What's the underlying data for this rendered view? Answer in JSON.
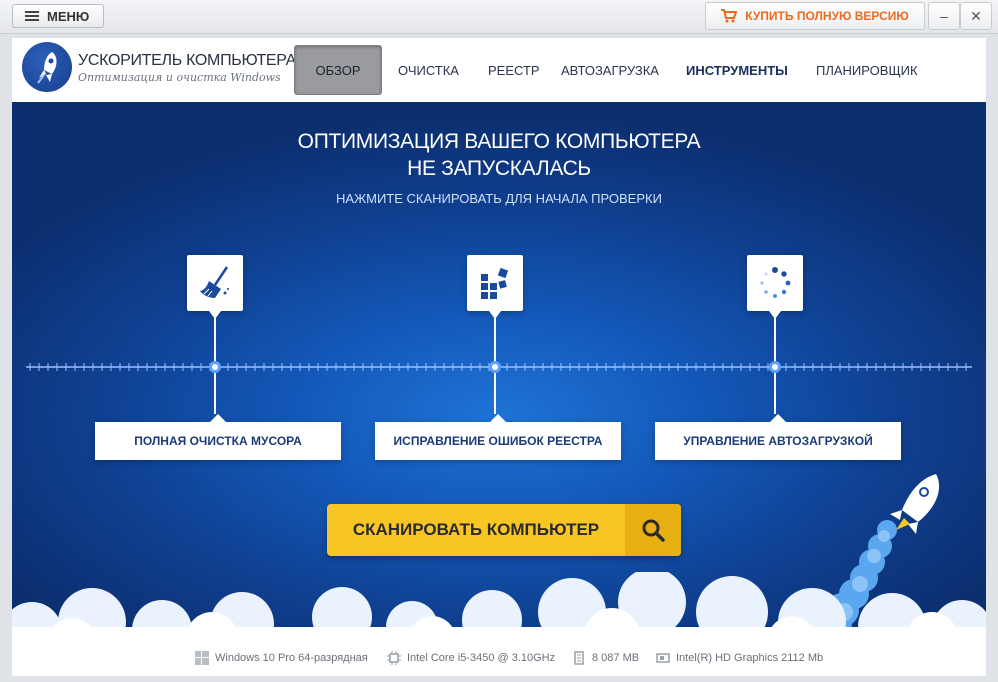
{
  "titlebar": {
    "menu_label": "МЕНЮ",
    "buy_label": "КУПИТЬ ПОЛНУЮ ВЕРСИЮ",
    "minimize_glyph": "–",
    "close_glyph": "✕",
    "accent_color": "#ef6a1f"
  },
  "app": {
    "title": "УСКОРИТЕЛЬ КОМПЬЮТЕРА",
    "subtitle": "Оптимизация и очистка Windows",
    "logo_icon": "rocket-icon"
  },
  "nav": {
    "items": [
      {
        "label": "ОБЗОР",
        "active": true
      },
      {
        "label": "ОЧИСТКА",
        "active": false
      },
      {
        "label": "РЕЕСТР",
        "active": false
      },
      {
        "label": "АВТОЗАГРУЗКА",
        "active": false
      },
      {
        "label": "ИНСТРУМЕНТЫ",
        "active": false
      },
      {
        "label": "ПЛАНИРОВЩИК",
        "active": false
      }
    ]
  },
  "hero": {
    "title_line1": "ОПТИМИЗАЦИЯ ВАШЕГО КОМПЬЮТЕРА",
    "title_line2": "НЕ ЗАПУСКАЛАСЬ",
    "subtitle": "НАЖМИТЕ СКАНИРОВАТЬ ДЛЯ НАЧАЛА ПРОВЕРКИ",
    "features": [
      {
        "label": "ПОЛНАЯ ОЧИСТКА МУСОРА",
        "icon": "broom-icon"
      },
      {
        "label": "ИСПРАВЛЕНИЕ ОШИБОК РЕЕСТРА",
        "icon": "registry-blocks-icon"
      },
      {
        "label": "УПРАВЛЕНИЕ АВТОЗАГРУЗКОЙ",
        "icon": "spinner-icon"
      }
    ],
    "scan_button": "СКАНИРОВАТЬ КОМПЬЮТЕР",
    "scan_color": "#f7c524"
  },
  "status": {
    "os": "Windows 10 Pro 64-разрядная",
    "cpu": "Intel Core i5-3450 @ 3.10GHz",
    "ram": "8 087 MB",
    "gpu": "Intel(R) HD Graphics 2112 Mb"
  }
}
